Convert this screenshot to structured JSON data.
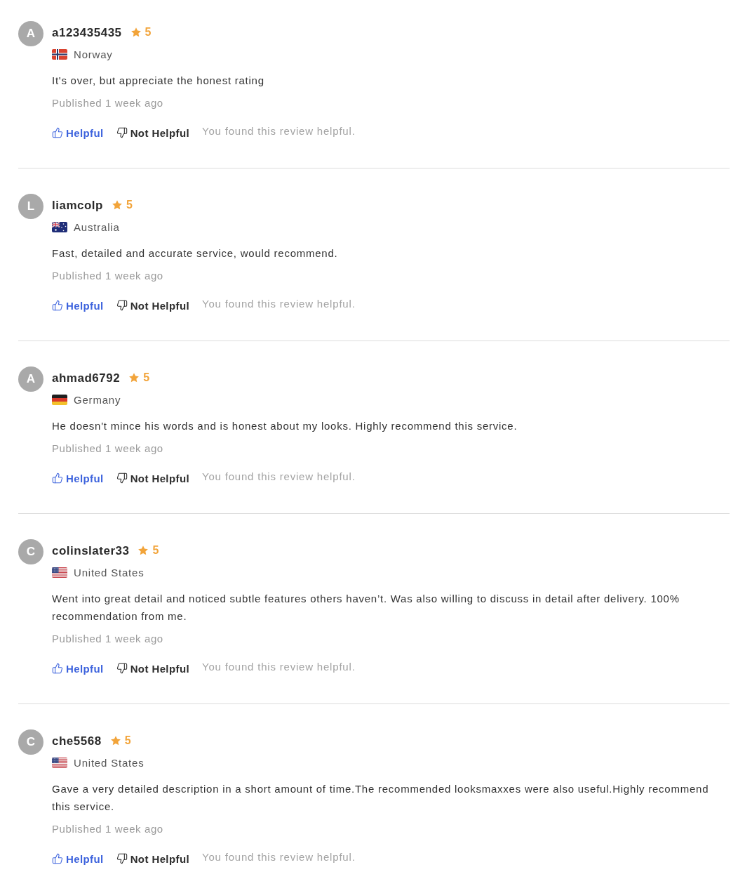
{
  "reviews": [
    {
      "avatar": "A",
      "name": "a123435435",
      "rating": "5",
      "kind": "norway",
      "country": "Norway",
      "text": "It's over, but appreciate the honest rating",
      "published": "Published 1 week ago",
      "helpful": {
        "label": "Helpful",
        "selected": true
      },
      "not_helpful": {
        "label": "Not Helpful",
        "selected": false
      },
      "feedback": "You found this review helpful."
    },
    {
      "avatar": "L",
      "name": "liamcolp",
      "rating": "5",
      "kind": "australia",
      "country": "Australia",
      "text": "Fast, detailed and accurate service, would recommend.",
      "published": "Published 1 week ago",
      "helpful": {
        "label": "Helpful",
        "selected": true
      },
      "not_helpful": {
        "label": "Not Helpful",
        "selected": false
      },
      "feedback": "You found this review helpful."
    },
    {
      "avatar": "A",
      "name": "ahmad6792",
      "rating": "5",
      "kind": "germany",
      "country": "Germany",
      "text": "He doesn't mince his words and is honest about my looks. Highly recommend this service.",
      "published": "Published 1 week ago",
      "helpful": {
        "label": "Helpful",
        "selected": true
      },
      "not_helpful": {
        "label": "Not Helpful",
        "selected": false
      },
      "feedback": "You found this review helpful."
    },
    {
      "avatar": "C",
      "name": "colinslater33",
      "rating": "5",
      "kind": "usa",
      "country": "United States",
      "text": "Went into great detail and noticed subtle features others haven’t. Was also willing to discuss in detail after delivery. 100% recommendation from me.",
      "published": "Published 1 week ago",
      "helpful": {
        "label": "Helpful",
        "selected": true
      },
      "not_helpful": {
        "label": "Not Helpful",
        "selected": false
      },
      "feedback": "You found this review helpful."
    },
    {
      "avatar": "C",
      "name": "che5568",
      "rating": "5",
      "kind": "usa",
      "country": "United States",
      "text": "Gave a very detailed description in a short amount of time.The recommended looksmaxxes were also useful.Highly recommend this service.",
      "published": "Published 1 week ago",
      "helpful": {
        "label": "Helpful",
        "selected": true
      },
      "not_helpful": {
        "label": "Not Helpful",
        "selected": false
      },
      "feedback": "You found this review helpful."
    }
  ]
}
